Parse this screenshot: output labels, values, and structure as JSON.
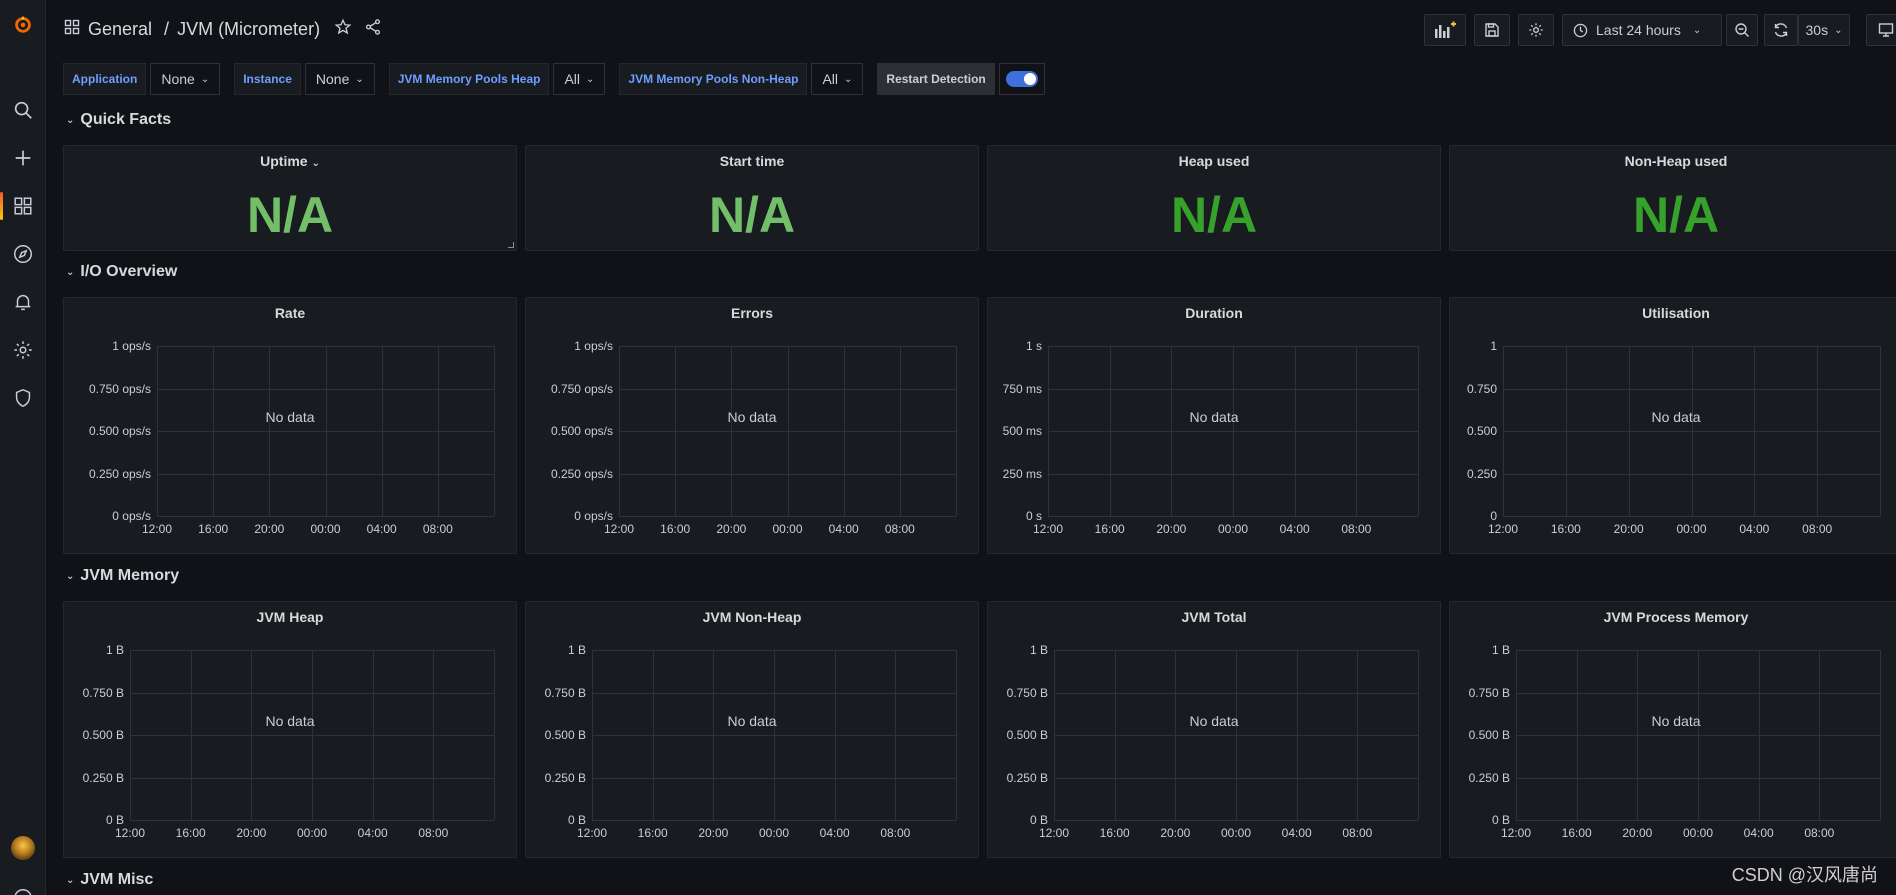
{
  "breadcrumb": {
    "folder": "General",
    "separator": "/",
    "dashboard": "JVM (Micrometer)"
  },
  "toolbar": {
    "time_range": "Last 24 hours",
    "refresh_interval": "30s"
  },
  "variables": [
    {
      "label": "Application",
      "value": "None"
    },
    {
      "label": "Instance",
      "value": "None"
    },
    {
      "label": "JVM Memory Pools Heap",
      "value": "All"
    },
    {
      "label": "JVM Memory Pools Non-Heap",
      "value": "All"
    }
  ],
  "restart_detection": {
    "label": "Restart Detection",
    "enabled": true
  },
  "rows": {
    "quick_facts": "Quick Facts",
    "io_overview": "I/O Overview",
    "jvm_memory": "JVM Memory",
    "jvm_misc": "JVM Misc"
  },
  "stats": [
    {
      "title": "Uptime",
      "value": "N/A",
      "color": "#73bf69"
    },
    {
      "title": "Start time",
      "value": "N/A",
      "color": "#73bf69"
    },
    {
      "title": "Heap used",
      "value": "N/A",
      "color": "#37a22b"
    },
    {
      "title": "Non-Heap used",
      "value": "N/A",
      "color": "#37a22b"
    }
  ],
  "io_panels": [
    {
      "title": "Rate",
      "no_data": "No data",
      "y_ticks": [
        "1 ops/s",
        "0.750 ops/s",
        "0.500 ops/s",
        "0.250 ops/s",
        "0 ops/s"
      ]
    },
    {
      "title": "Errors",
      "no_data": "No data",
      "y_ticks": [
        "1 ops/s",
        "0.750 ops/s",
        "0.500 ops/s",
        "0.250 ops/s",
        "0 ops/s"
      ]
    },
    {
      "title": "Duration",
      "no_data": "No data",
      "y_ticks": [
        "1 s",
        "750 ms",
        "500 ms",
        "250 ms",
        "0 s"
      ]
    },
    {
      "title": "Utilisation",
      "no_data": "No data",
      "y_ticks": [
        "1",
        "0.750",
        "0.500",
        "0.250",
        "0"
      ]
    }
  ],
  "memory_panels": [
    {
      "title": "JVM Heap",
      "no_data": "No data",
      "y_ticks": [
        "1 B",
        "0.750 B",
        "0.500 B",
        "0.250 B",
        "0 B"
      ]
    },
    {
      "title": "JVM Non-Heap",
      "no_data": "No data",
      "y_ticks": [
        "1 B",
        "0.750 B",
        "0.500 B",
        "0.250 B",
        "0 B"
      ]
    },
    {
      "title": "JVM Total",
      "no_data": "No data",
      "y_ticks": [
        "1 B",
        "0.750 B",
        "0.500 B",
        "0.250 B",
        "0 B"
      ]
    },
    {
      "title": "JVM Process Memory",
      "no_data": "No data",
      "y_ticks": [
        "1 B",
        "0.750 B",
        "0.500 B",
        "0.250 B",
        "0 B"
      ]
    }
  ],
  "x_ticks": [
    "12:00",
    "16:00",
    "20:00",
    "00:00",
    "04:00",
    "08:00"
  ],
  "watermark": "CSDN @汉风唐尚"
}
